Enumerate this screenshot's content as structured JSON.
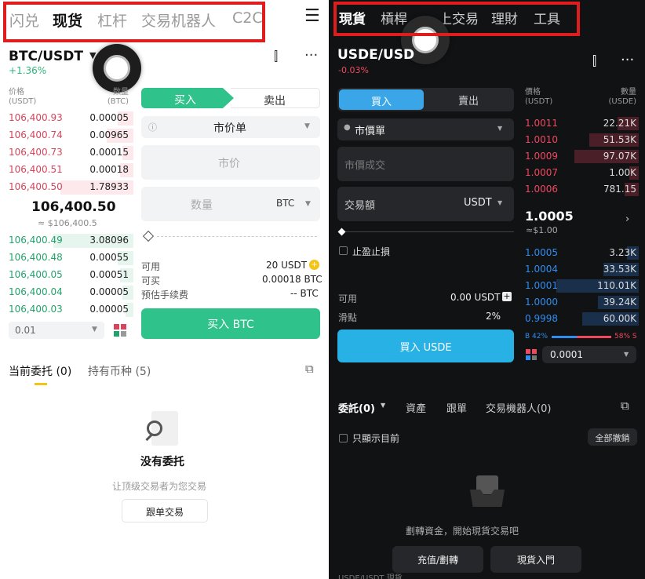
{
  "left": {
    "tabs": [
      "闪兑",
      "现货",
      "杠杆",
      "交易机器人",
      "C2C"
    ],
    "menu_icon": "☰",
    "pair": "BTC/USDT",
    "change": "+1.36%",
    "header_price": "价格",
    "header_price_unit": "(USDT)",
    "header_qty": "数量",
    "header_qty_unit": "(BTC)",
    "asks": [
      [
        "106,400.93",
        "0.00005"
      ],
      [
        "106,400.74",
        "0.00965"
      ],
      [
        "106,400.73",
        "0.00015"
      ],
      [
        "106,400.51",
        "0.00018"
      ],
      [
        "106,400.50",
        "1.78933"
      ]
    ],
    "mid_price": "106,400.50",
    "mid_sub": "≈ $106,400.5",
    "bids": [
      [
        "106,400.49",
        "3.08096"
      ],
      [
        "106,400.48",
        "0.00055"
      ],
      [
        "106,400.05",
        "0.00051"
      ],
      [
        "106,400.04",
        "0.00005"
      ],
      [
        "106,400.03",
        "0.00005"
      ]
    ],
    "precision": "0.01",
    "buy_tab": "买入",
    "sell_tab": "卖出",
    "order_type": "市价单",
    "price_placeholder": "市价",
    "qty_placeholder": "数量",
    "qty_unit": "BTC",
    "available_label": "可用",
    "available_value": "20 USDT",
    "canbuy_label": "可买",
    "canbuy_value": "0.00018 BTC",
    "fee_label": "预估手续费",
    "fee_value": "-- BTC",
    "buy_button": "买入 BTC",
    "order_tab1": "当前委托 (0)",
    "order_tab2": "持有币种 (5)",
    "empty_title": "没有委托",
    "empty_sub": "让顶级交易者为您交易",
    "copy_button": "跟单交易"
  },
  "right": {
    "tabs": [
      "現貨",
      "槓桿",
      "上交易",
      "理財",
      "工具"
    ],
    "pair": "USDE/USD",
    "change": "-0.03%",
    "buy_tab": "買入",
    "sell_tab": "賣出",
    "order_type": "市價單",
    "price_placeholder": "市價成交",
    "amount_label": "交易額",
    "amount_unit": "USDT",
    "tpsl": "止盈止損",
    "available_label": "可用",
    "available_value": "0.00 USDT",
    "slippage_label": "滑點",
    "slippage_value": "2%",
    "buy_button": "買入 USDE",
    "header_price": "價格",
    "header_price_unit": "(USDT)",
    "header_qty": "數量",
    "header_qty_unit": "(USDE)",
    "asks": [
      [
        "1.0011",
        "22.21K"
      ],
      [
        "1.0010",
        "51.53K"
      ],
      [
        "1.0009",
        "97.07K"
      ],
      [
        "1.0007",
        "1.00K"
      ],
      [
        "1.0006",
        "781.15"
      ]
    ],
    "mid_price": "1.0005",
    "mid_sub": "≈$1.00",
    "bids": [
      [
        "1.0005",
        "3.23K"
      ],
      [
        "1.0004",
        "33.53K"
      ],
      [
        "1.0001",
        "110.01K"
      ],
      [
        "1.0000",
        "39.24K"
      ],
      [
        "0.9998",
        "60.00K"
      ]
    ],
    "ratio_buy": "B 42%",
    "ratio_sell": "58% S",
    "precision": "0.0001",
    "order_tabs": [
      "委託(0)",
      "資產",
      "跟單",
      "交易機器人(0)"
    ],
    "only_current": "只顯示目前",
    "cancel_all": "全部撤銷",
    "empty_sub": "劃轉資金，開始現貨交易吧",
    "deposit_button": "充值/劃轉",
    "intro_button": "現貨入門",
    "bottom_partial": "USDE/USDT 現貨"
  }
}
